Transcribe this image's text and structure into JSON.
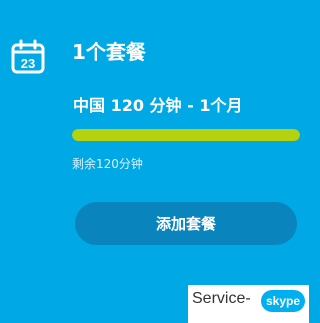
{
  "plan_card": {
    "calendar_day": "23",
    "title": "1个套餐",
    "plan_name": "中国 120 分钟 - 1个月",
    "usage_fraction_remaining": 1.0,
    "remaining_text": "剩余120分钟",
    "add_button_label": "添加套餐"
  },
  "watermark": {
    "text": "Service-",
    "logo_text": "skype"
  },
  "colors": {
    "background": "#00a8e6",
    "progress": "#b4d20e",
    "button": "#0a84bd",
    "skype_blue": "#00aff0"
  },
  "icons": [
    "calendar-icon",
    "skype-logo"
  ]
}
